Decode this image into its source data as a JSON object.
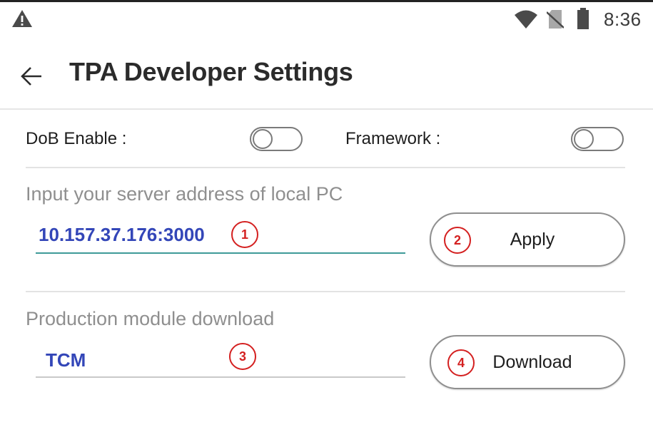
{
  "status_bar": {
    "time": "8:36",
    "icons": [
      "warning-icon",
      "wifi-icon",
      "no-sim-icon",
      "battery-icon"
    ]
  },
  "app_bar": {
    "back_icon": "arrow-left-icon",
    "title": "TPA Developer Settings"
  },
  "toggles": {
    "dob_label": "DoB Enable :",
    "dob_enabled": false,
    "framework_label": "Framework :",
    "framework_enabled": false
  },
  "server_section": {
    "label": "Input your server address of local PC",
    "value": "10.157.37.176:3000",
    "apply_label": "Apply"
  },
  "download_section": {
    "label": "Production module download",
    "value": "TCM",
    "download_label": "Download"
  },
  "markers": [
    "1",
    "2",
    "3",
    "4"
  ],
  "colors": {
    "field_text": "#3346b8",
    "focused_underline": "#3e9a98",
    "marker": "#d42020"
  }
}
